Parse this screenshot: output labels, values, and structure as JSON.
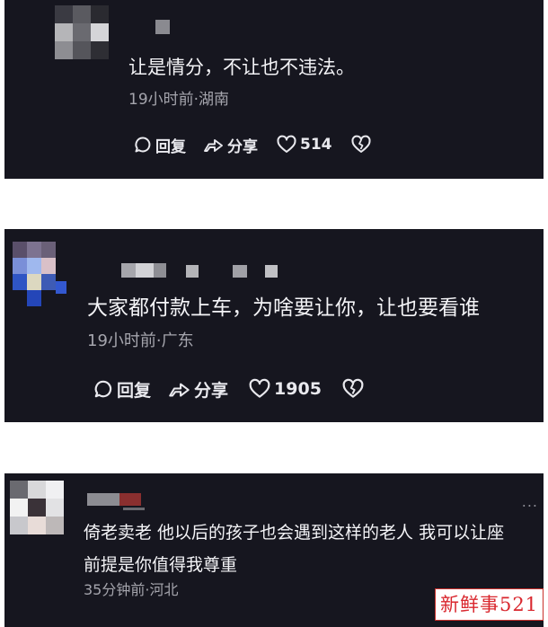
{
  "comments": [
    {
      "text": "让是情分，不让也不违法。",
      "meta": "19小时前·湖南",
      "reply_label": "回复",
      "share_label": "分享",
      "likes": "514"
    },
    {
      "text": "大家都付款上车，为啥要让你，让也要看谁",
      "meta": "19小时前·广东",
      "reply_label": "回复",
      "share_label": "分享",
      "likes": "1905"
    },
    {
      "text_line1": "倚老卖老 他以后的孩子也会遇到这样的老人 我可以让座",
      "text_line2": "前提是你值得我尊重",
      "meta": "35分钟前·河北",
      "more_label": "..."
    }
  ],
  "watermark": "新鲜事521",
  "colors": {
    "card_bg": "#16161f",
    "text": "#f4f4f7",
    "meta": "#a5a5ad",
    "watermark_red": "#d9272e"
  },
  "icons": [
    "comment-bubble-icon",
    "share-arrow-icon",
    "heart-outline-icon",
    "heart-broken-icon",
    "more-dots-icon"
  ]
}
